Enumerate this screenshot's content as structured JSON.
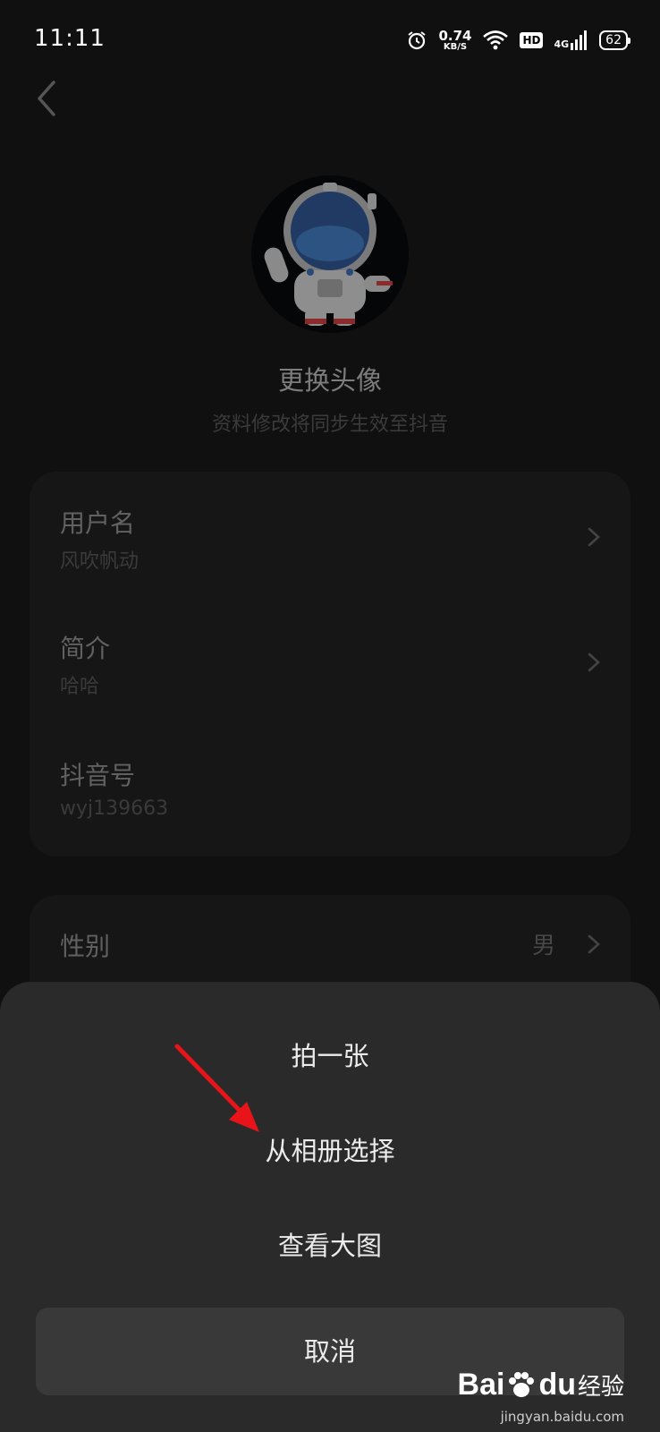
{
  "status_bar": {
    "time": "11:11",
    "speed_value": "0.74",
    "speed_unit": "KB/S",
    "hd": "HD",
    "network": "4G",
    "battery": "62"
  },
  "profile": {
    "change_avatar": "更换头像",
    "sync_hint": "资料修改将同步生效至抖音"
  },
  "fields": {
    "username_label": "用户名",
    "username_value": "风吹帆动",
    "bio_label": "简介",
    "bio_value": "哈哈",
    "douyin_id_label": "抖音号",
    "douyin_id_value": "wyj139663",
    "gender_label": "性别",
    "gender_value": "男"
  },
  "action_sheet": {
    "take_photo": "拍一张",
    "choose_from_album": "从相册选择",
    "view_large": "查看大图",
    "cancel": "取消"
  },
  "watermark": {
    "logo": "Bai",
    "logo2": "du",
    "label": "经验",
    "url": "jingyan.baidu.com"
  },
  "colors": {
    "annotation_arrow": "#e8141a",
    "sheet_bg": "#2a2a2a"
  }
}
